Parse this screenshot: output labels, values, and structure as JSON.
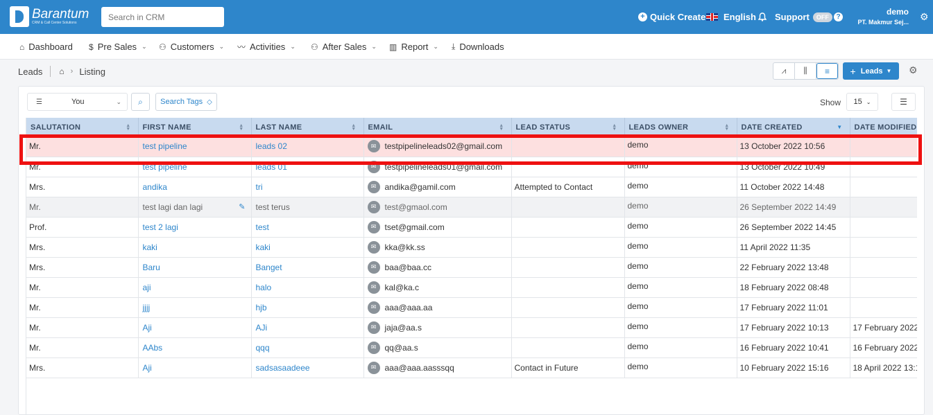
{
  "brand": {
    "name": "Barantum",
    "tagline": "CRM & Call Center Solutions"
  },
  "search": {
    "placeholder": "Search in CRM"
  },
  "topbar": {
    "quick_create": "Quick Create",
    "language": "English",
    "support": "Support",
    "support_state": "OFF",
    "user_name": "demo",
    "company": "PT. Makmur Sej..."
  },
  "nav": [
    {
      "label": "Dashboard",
      "icon": "home-icon",
      "dropdown": false
    },
    {
      "label": "Pre Sales",
      "icon": "dollar-icon",
      "dropdown": true
    },
    {
      "label": "Customers",
      "icon": "users-icon",
      "dropdown": true
    },
    {
      "label": "Activities",
      "icon": "pulse-icon",
      "dropdown": true
    },
    {
      "label": "After Sales",
      "icon": "user-group-icon",
      "dropdown": true
    },
    {
      "label": "Report",
      "icon": "bar-chart-icon",
      "dropdown": true
    },
    {
      "label": "Downloads",
      "icon": "download-icon",
      "dropdown": false
    }
  ],
  "breadcrumb": {
    "module": "Leads",
    "page": "Listing"
  },
  "actions": {
    "add_label": "Leads"
  },
  "toolbar": {
    "filter_value": "You",
    "tags_label": "Search Tags",
    "show_label": "Show",
    "page_size": "15"
  },
  "table": {
    "columns": [
      "SALUTATION",
      "FIRST NAME",
      "LAST NAME",
      "EMAIL",
      "LEAD STATUS",
      "LEADS OWNER",
      "DATE CREATED",
      "DATE MODIFIED"
    ],
    "rows": [
      {
        "salutation": "Mr.",
        "first": "test pipeline",
        "last": "leads 02",
        "email": "testpipelineleads02@gmail.com",
        "status": "",
        "owner": "demo",
        "created": "13 October 2022 10:56",
        "modified": ""
      },
      {
        "salutation": "Mr.",
        "first": "test pipeline",
        "last": "leads 01",
        "email": "testpipelineleads01@gmail.com",
        "status": "",
        "owner": "demo",
        "created": "13 October 2022 10:49",
        "modified": ""
      },
      {
        "salutation": "Mrs.",
        "first": "andika",
        "last": "tri",
        "email": "andika@gamil.com",
        "status": "Attempted to Contact",
        "owner": "demo",
        "created": "11 October 2022 14:48",
        "modified": ""
      },
      {
        "salutation": "Mr.",
        "first": "test lagi dan lagi",
        "last": "test terus",
        "email": "test@gmaol.com",
        "status": "",
        "owner": "demo",
        "created": "26 September 2022 14:49",
        "modified": ""
      },
      {
        "salutation": "Prof.",
        "first": "test 2 lagi",
        "last": "test",
        "email": "tset@gmail.com",
        "status": "",
        "owner": "demo",
        "created": "26 September 2022 14:45",
        "modified": ""
      },
      {
        "salutation": "Mrs.",
        "first": "kaki",
        "last": "kaki",
        "email": "kka@kk.ss",
        "status": "",
        "owner": "demo",
        "created": "11 April 2022 11:35",
        "modified": ""
      },
      {
        "salutation": "Mrs.",
        "first": "Baru",
        "last": "Banget",
        "email": "baa@baa.cc",
        "status": "",
        "owner": "demo",
        "created": "22 February 2022 13:48",
        "modified": ""
      },
      {
        "salutation": "Mr.",
        "first": "aji",
        "last": "halo",
        "email": "kal@ka.c",
        "status": "",
        "owner": "demo",
        "created": "18 February 2022 08:48",
        "modified": ""
      },
      {
        "salutation": "Mr.",
        "first": "jjjj",
        "last": "hjb",
        "email": "aaa@aaa.aa",
        "status": "",
        "owner": "demo",
        "created": "17 February 2022 11:01",
        "modified": ""
      },
      {
        "salutation": "Mr.",
        "first": "Aji",
        "last": "AJi",
        "email": "jaja@aa.s",
        "status": "",
        "owner": "demo",
        "created": "17 February 2022 10:13",
        "modified": "17 February 2022"
      },
      {
        "salutation": "Mr.",
        "first": "AAbs",
        "last": "qqq",
        "email": "qq@aa.s",
        "status": "",
        "owner": "demo",
        "created": "16 February 2022 10:41",
        "modified": "16 February 2022"
      },
      {
        "salutation": "Mrs.",
        "first": "Aji",
        "last": "sadsasaadeee",
        "email": "aaa@aaa.aasssqq",
        "status": "Contact in Future",
        "owner": "demo",
        "created": "10 February 2022 15:16",
        "modified": "18 April 2022 13:1"
      }
    ]
  },
  "colors": {
    "brand": "#2e86cb",
    "header_bg": "#c8daef",
    "highlight_row": "#fde0e0",
    "annotation": "#ee1111"
  }
}
